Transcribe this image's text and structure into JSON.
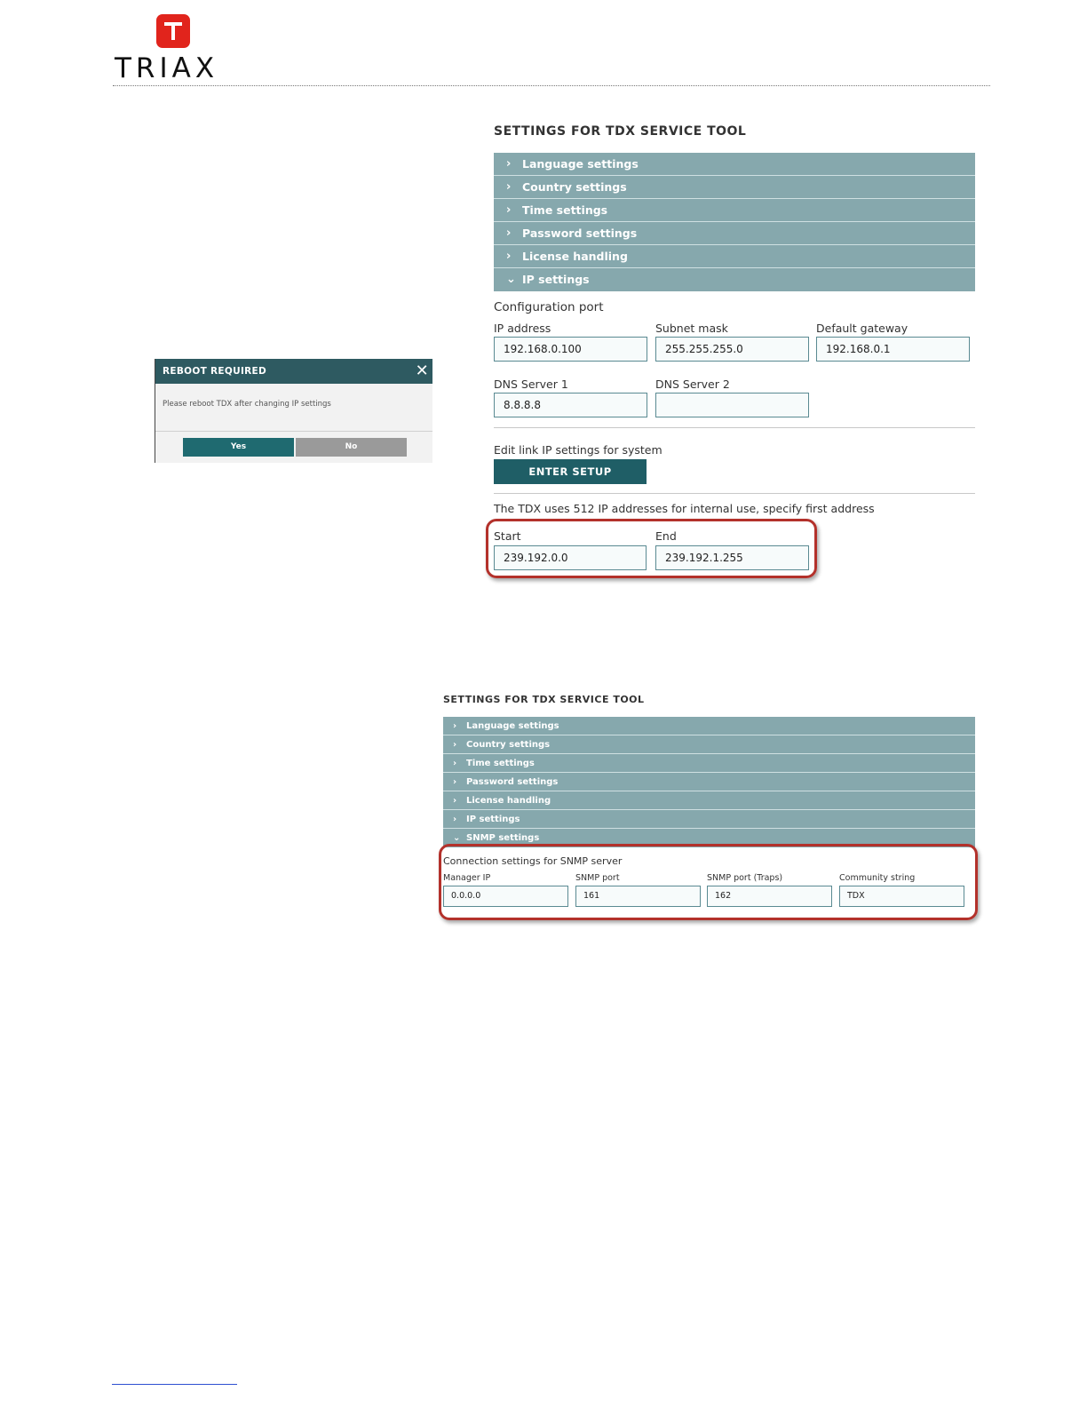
{
  "logo": {
    "wordmark": "TRIAX"
  },
  "reboot_dialog": {
    "title": "REBOOT REQUIRED",
    "message": "Please reboot TDX after changing IP settings",
    "yes_label": "Yes",
    "no_label": "No"
  },
  "panel_ip": {
    "title": "SETTINGS FOR TDX SERVICE TOOL",
    "menu": [
      "Language settings",
      "Country settings",
      "Time settings",
      "Password settings",
      "License handling",
      "IP settings"
    ],
    "config_port_heading": "Configuration port",
    "ip_address": {
      "label": "IP address",
      "value": "192.168.0.100"
    },
    "subnet_mask": {
      "label": "Subnet mask",
      "value": "255.255.255.0"
    },
    "default_gateway": {
      "label": "Default gateway",
      "value": "192.168.0.1"
    },
    "dns1": {
      "label": "DNS Server 1",
      "value": "8.8.8.8"
    },
    "dns2": {
      "label": "DNS Server 2",
      "value": ""
    },
    "edit_link_text": "Edit link IP settings for system",
    "enter_setup_label": "ENTER SETUP",
    "internal_range_text": "The TDX uses 512 IP addresses for internal use, specify first address",
    "start": {
      "label": "Start",
      "value": "239.192.0.0"
    },
    "end": {
      "label": "End",
      "value": "239.192.1.255"
    }
  },
  "panel_snmp": {
    "title": "SETTINGS FOR TDX SERVICE TOOL",
    "menu": [
      "Language settings",
      "Country settings",
      "Time settings",
      "Password settings",
      "License handling",
      "IP settings",
      "SNMP settings"
    ],
    "connection_heading": "Connection settings for SNMP server",
    "manager_ip": {
      "label": "Manager IP",
      "value": "0.0.0.0"
    },
    "snmp_port": {
      "label": "SNMP port",
      "value": "161"
    },
    "snmp_port_traps": {
      "label": "SNMP port (Traps)",
      "value": "162"
    },
    "community_string": {
      "label": "Community string",
      "value": "TDX"
    }
  },
  "colors": {
    "brand_red": "#e1241c",
    "accordion": "#86a8ad",
    "dialog_header": "#2e5a61",
    "highlight": "#b3312b"
  }
}
